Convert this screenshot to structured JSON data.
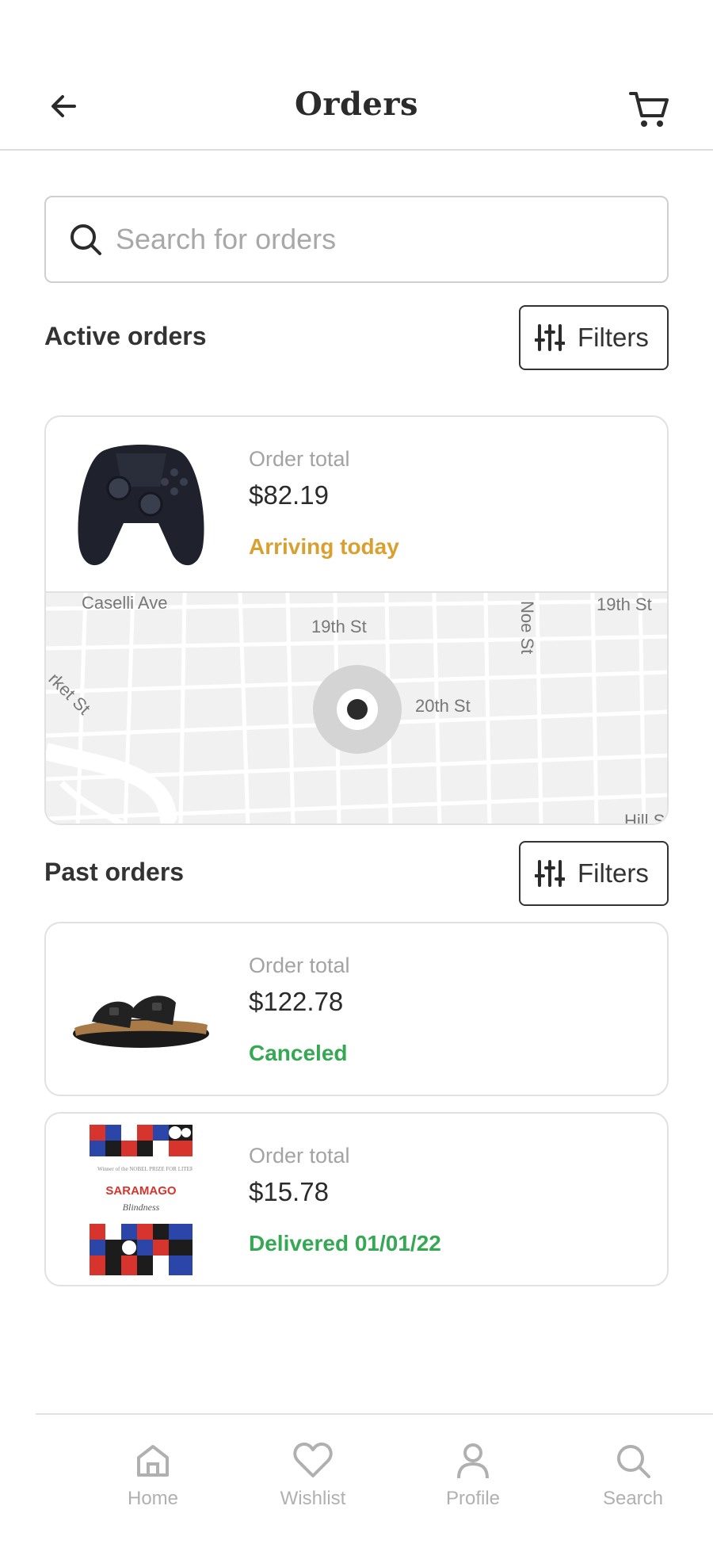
{
  "header": {
    "title": "Orders",
    "back_icon": "arrow-left-icon",
    "cart_icon": "cart-icon"
  },
  "search": {
    "placeholder": "Search for orders",
    "value": "",
    "icon": "search-icon"
  },
  "active_orders": {
    "title": "Active orders",
    "filters_label": "Filters",
    "filters_icon": "sliders-icon",
    "orders": [
      {
        "product": "game-controller",
        "label": "Order total",
        "total": "$82.19",
        "status": "Arriving today",
        "status_color": "#D9A030",
        "map": {
          "streets": [
            "Caselli Ave",
            "19th St",
            "Noe St",
            "19th St",
            "rket St",
            "20th St",
            "Hill S"
          ]
        }
      }
    ]
  },
  "past_orders": {
    "title": "Past orders",
    "filters_label": "Filters",
    "orders": [
      {
        "product": "sandal",
        "label": "Order total",
        "total": "$122.78",
        "status": "Canceled",
        "status_color": "#34A853"
      },
      {
        "product": "book",
        "label": "Order total",
        "total": "$15.78",
        "status": "Delivered 01/01/22",
        "status_color": "#34A853",
        "book_cover": {
          "author": "SARAMAGO",
          "title": "Blindness",
          "tagline": "Winner of the NOBEL PRIZE FOR LITERATURE"
        }
      }
    ]
  },
  "bottom_nav": {
    "items": [
      {
        "label": "Home",
        "icon": "home-icon"
      },
      {
        "label": "Wishlist",
        "icon": "heart-icon"
      },
      {
        "label": "Profile",
        "icon": "user-icon"
      },
      {
        "label": "Search",
        "icon": "search-icon"
      }
    ]
  },
  "colors": {
    "accent_arriving": "#D9A030",
    "accent_success": "#34A853",
    "muted_text": "#A3A3A3",
    "border": "#E1E1E1"
  }
}
